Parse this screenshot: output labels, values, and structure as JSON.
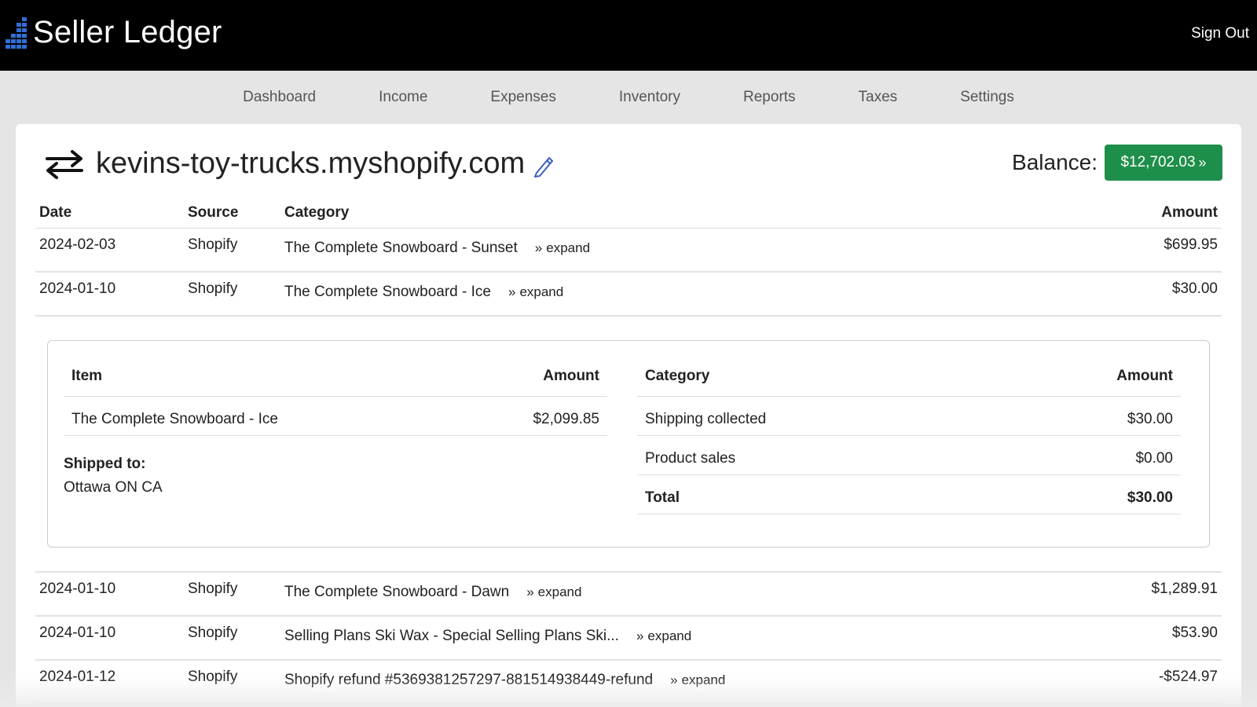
{
  "app": {
    "name": "Seller Ledger",
    "sign_out": "Sign Out"
  },
  "nav": [
    "Dashboard",
    "Income",
    "Expenses",
    "Inventory",
    "Reports",
    "Taxes",
    "Settings"
  ],
  "account": {
    "name": "kevins-toy-trucks.myshopify.com"
  },
  "balance": {
    "label": "Balance:",
    "value": "$12,702.03"
  },
  "table": {
    "headers": {
      "date": "Date",
      "source": "Source",
      "category": "Category",
      "amount": "Amount"
    },
    "expand_label": "expand",
    "rows": [
      {
        "date": "2024-02-03",
        "source": "Shopify",
        "category": "The Complete Snowboard - Sunset",
        "amount": "$699.95"
      },
      {
        "date": "2024-01-10",
        "source": "Shopify",
        "category": "The Complete Snowboard - Ice",
        "amount": "$30.00"
      },
      {
        "date": "2024-01-10",
        "source": "Shopify",
        "category": "The Complete Snowboard - Dawn",
        "amount": "$1,289.91"
      },
      {
        "date": "2024-01-10",
        "source": "Shopify",
        "category": "Selling Plans Ski Wax - Special Selling Plans Ski...",
        "amount": "$53.90"
      },
      {
        "date": "2024-01-12",
        "source": "Shopify",
        "category": "Shopify refund #5369381257297-881514938449-refund",
        "amount": "-$524.97"
      }
    ]
  },
  "detail": {
    "items_headers": {
      "item": "Item",
      "amount": "Amount"
    },
    "items": [
      {
        "item": "The Complete Snowboard - Ice",
        "amount": "$2,099.85"
      }
    ],
    "shipped_label": "Shipped to:",
    "shipped_to": "Ottawa ON CA",
    "cat_headers": {
      "category": "Category",
      "amount": "Amount"
    },
    "categories": [
      {
        "category": "Shipping collected",
        "amount": "$30.00"
      },
      {
        "category": "Product sales",
        "amount": "$0.00"
      }
    ],
    "total": {
      "label": "Total",
      "amount": "$30.00"
    }
  },
  "colors": {
    "topbar": "#000000",
    "accent_green": "#1e8f4a",
    "logo_blue": "#2f6fd6",
    "page_bg": "#e5e5e5"
  }
}
